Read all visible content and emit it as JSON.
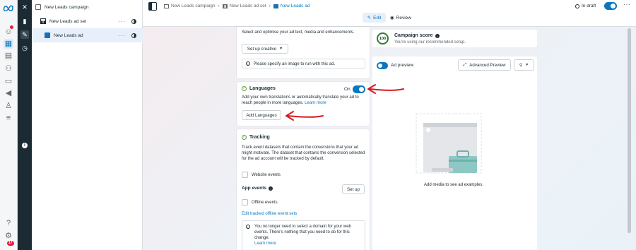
{
  "breadcrumbs": [
    {
      "label": "New Leads campaign"
    },
    {
      "label": "New Leads ad set"
    },
    {
      "label": "New Leads ad"
    }
  ],
  "tabs": {
    "edit": "Edit",
    "review": "Review"
  },
  "status": {
    "draft": "In draft"
  },
  "tree": {
    "campaign": "New Leads campaign",
    "adset": "New Leads ad set",
    "ad": "New Leads ad"
  },
  "creative": {
    "intro": "Select and optimise your ad text, media and enhancements.",
    "setup_label": "Set up creative",
    "image_notice": "Please specify an image to run with this ad."
  },
  "languages": {
    "title": "Languages",
    "toggle_label": "On",
    "desc": "Add your own translations or automatically translate your ad to reach people in more languages.",
    "learn_more": "Learn more",
    "add_button": "Add Languages"
  },
  "tracking": {
    "title": "Tracking",
    "desc": "Track event datasets that contain the conversions that your ad might motivate. The dataset that contains the conversion selected for the ad account will be tracked by default.",
    "website_events": "Website events",
    "app_events": "App events",
    "setup_button": "Set up",
    "offline_events": "Offline events",
    "edit_offline_link": "Edit tracked offline event sets",
    "domain_notice": "You no longer need to select a domain for your web events. There's nothing that you need to do for this change.",
    "learn_more": "Learn more"
  },
  "campaign_score": {
    "value": "100",
    "title": "Campaign score",
    "subtitle": "You're using our recommended setup."
  },
  "preview": {
    "toggle_label": "Ad preview",
    "advanced_button": "Advanced Preview",
    "empty_text": "Add media to see ad examples."
  },
  "notifications": {
    "count": "17"
  },
  "colors": {
    "accent": "#0a78be",
    "arrow": "#d71920",
    "dark_panel": "#1c2b33"
  },
  "icons": [
    "meta-logo",
    "chart-icon",
    "smiley-icon",
    "grid-icon",
    "pages-icon",
    "audience-icon",
    "billing-icon",
    "megaphone-icon",
    "people-icon",
    "menu-icon",
    "help-icon",
    "settings-icon"
  ]
}
